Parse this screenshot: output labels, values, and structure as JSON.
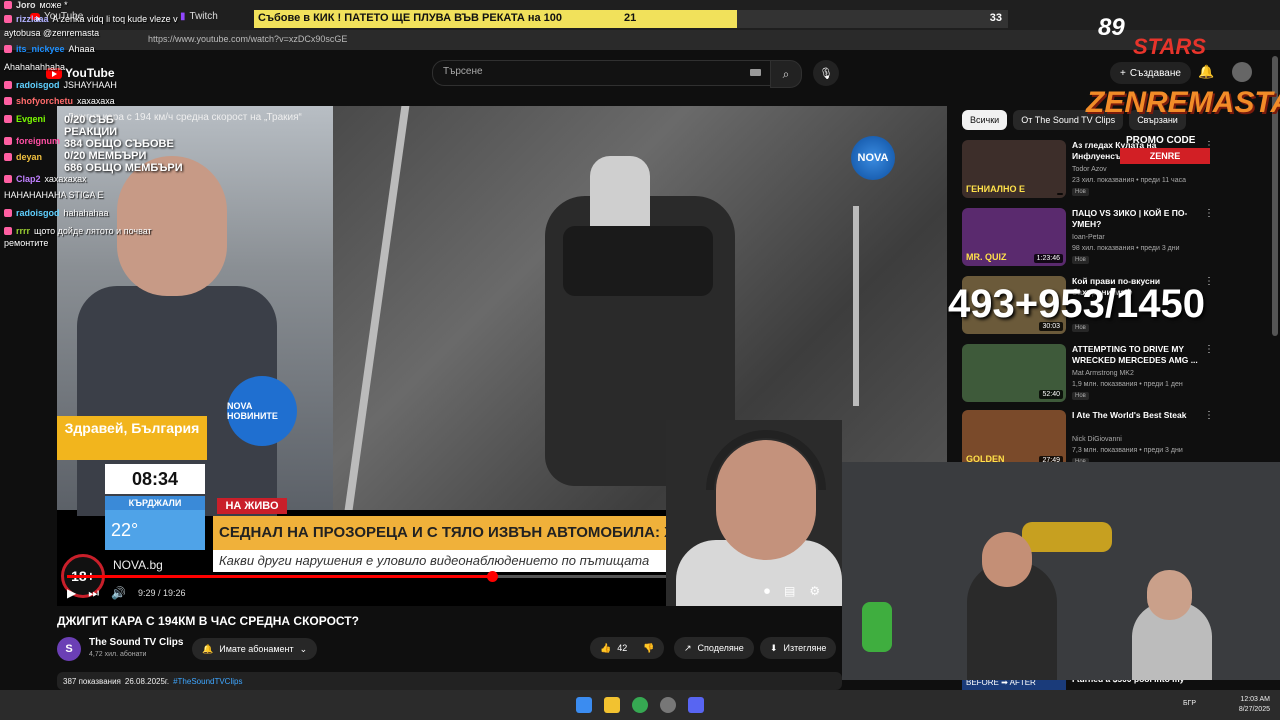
{
  "browser": {
    "tabs": [
      {
        "label": "YouTube"
      },
      {
        "label": "Twitch"
      }
    ],
    "url": "https://www.youtube.com/watch?v=xzDCx90scGE"
  },
  "youtube": {
    "logo_text": "YouTube",
    "search_placeholder": "Търсене",
    "create_label": "Създаване"
  },
  "video": {
    "overlay_title": "Джигит кара с 194 км/ч средна скорост на „Тракия“",
    "nova_logo": "NOVA",
    "mic_brand": "NOVA НОВИНИТЕ",
    "show_name": "Здравей, България",
    "clock": "08:34",
    "city": "КЪРДЖАЛИ",
    "temperature": "22°",
    "live_tag": "НА ЖИВО",
    "headline": "СЕДНАЛ НА ПРОЗОРЕЦА И С ТЯЛО ИЗВЪН АВТОМОБИЛА: ХВАНАХА НАРУШИТЕЛЯ",
    "subline": "Какви други нарушения е уловило видеонаблюдението по пътищата",
    "website": "NOVA.bg",
    "age_rating": "18+",
    "time": "9:29 / 19:26",
    "progress": 0.488
  },
  "below": {
    "title": "ДЖИГИТ КАРА С 194КМ В ЧАС СРЕДНА СКОРОСТ?",
    "channel_name": "The Sound TV Clips",
    "subscribers": "4,72 хил. абонати",
    "subscribed_label": "Имате абонамент",
    "likes": "42",
    "share_label": "Споделяне",
    "download_label": "Изтегляне",
    "views": "387 показвания",
    "date": "26.08.2025г.",
    "hashtag": "#TheSoundTVClips"
  },
  "sidebar": {
    "chips": [
      "Всички",
      "От The Sound TV Clips",
      "Свързани"
    ],
    "recommendations": [
      {
        "title": "Аз гледах Кулата на Инфлуенсърите, за да не го гледате вие",
        "channel": "Todor Azov",
        "meta": "23 хил. показвания • преди 11 часа",
        "badge": "Нов",
        "thumb_text": "ГЕНИАЛНО Е",
        "duration": "",
        "color": "#3d2e2a"
      },
      {
        "title": "ПАЦО VS ЗИКО | КОЙ Е ПО-УМЕН?",
        "channel": "Ioan-Petar",
        "meta": "98 хил. показвания • преди 3 дни",
        "badge": "Нов",
        "thumb_text": "MR. QUIZ",
        "duration": "1:23:46",
        "color": "#5a2a6e"
      },
      {
        "title": "Кой прави по-вкусни бахурени маф",
        "channel": "",
        "meta": "",
        "badge": "Нов",
        "thumb_text": "",
        "duration": "30:03",
        "color": "#6b5a3a"
      },
      {
        "title": "ATTEMPTING TO DRIVE MY WRECKED MERCEDES AMG ...",
        "channel": "Mat Armstrong MK2",
        "meta": "1,9 млн. показвания • преди 1 ден",
        "badge": "Нов",
        "thumb_text": "",
        "duration": "52:40",
        "color": "#3e5a3a"
      },
      {
        "title": "I Ate The World's Best Steak",
        "channel": "Nick DiGiovanni",
        "meta": "7,3 млн. показвания • преди 3 дни",
        "badge": "Нов",
        "thumb_text": "GOLDEN",
        "duration": "27:49",
        "color": "#7a4a2a"
      }
    ],
    "last_title": "I turned a $500 pool into my",
    "last_thumb": "BEFORE ➡ AFTER"
  },
  "chat": [
    {
      "user": "Joro",
      "text": "може *",
      "color": "#e0e0e0"
    },
    {
      "user": "rizzlaaa",
      "text": "A zenka vidq li toq kude vleze v",
      "color": "#b0b0ff"
    },
    {
      "user": "",
      "text": "aytobusa @zenremasta",
      "color": "#fff"
    },
    {
      "user": "its_nickyee",
      "text": "Ahaaa",
      "color": "#1e90ff"
    },
    {
      "user": "",
      "text": "Ahahahahhaha",
      "color": "#fff"
    },
    {
      "user": "radoisgod",
      "text": "JSHAYHAAH",
      "color": "#5fd0ff"
    },
    {
      "user": "shofyorchetu",
      "text": "хахахаха",
      "color": "#ff6b6b"
    },
    {
      "user": "Evgeni",
      "text": "",
      "color": "#7cfc00"
    },
    {
      "user": "foreignum",
      "text": "",
      "color": "#ff4fa3"
    },
    {
      "user": "deyan",
      "text": "",
      "color": "#f0c040"
    },
    {
      "user": "Clap2",
      "text": "хахахахах",
      "color": "#c080ff"
    },
    {
      "user": "",
      "text": "HAHAHAHAHA STIGA E",
      "color": "#fff"
    },
    {
      "user": "radoisgod",
      "text": "hahahahaa",
      "color": "#5fd0ff"
    },
    {
      "user": "rrrr",
      "text": "щото дойде лятото и почват",
      "color": "#9acd32"
    },
    {
      "user": "",
      "text": "ремонтите",
      "color": "#fff"
    }
  ],
  "overlays": {
    "poll_question": "Събове в КИК ! ПАТЕТО ЩЕ ПЛУВА ВЪВ РЕКАТА на 100",
    "poll_a": "21",
    "poll_b": "33",
    "poll_fill": 0.64,
    "stats": [
      "0/20 СЪБ",
      "РЕАКЦИИ",
      "384 ОБЩО СЪБОВЕ",
      "0/20 МЕМБЪРИ",
      "686 ОБЩО МЕМБЪРИ"
    ],
    "counter": "493+953/1450",
    "stars_num": "89",
    "stars_word": "STARS",
    "brand": "ZENREMASTA",
    "promo_label": "PROMO CODE",
    "promo_code": "ZENRE"
  },
  "taskbar": {
    "lang": "БГР",
    "time": "12:03 AM",
    "date": "8/27/2025"
  }
}
